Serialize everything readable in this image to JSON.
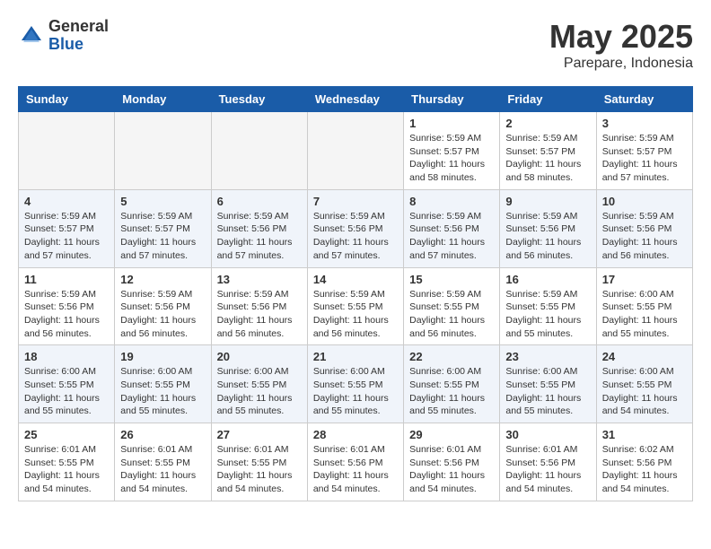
{
  "header": {
    "logo_general": "General",
    "logo_blue": "Blue",
    "month_title": "May 2025",
    "location": "Parepare, Indonesia"
  },
  "weekdays": [
    "Sunday",
    "Monday",
    "Tuesday",
    "Wednesday",
    "Thursday",
    "Friday",
    "Saturday"
  ],
  "weeks": [
    [
      {
        "day": "",
        "info": ""
      },
      {
        "day": "",
        "info": ""
      },
      {
        "day": "",
        "info": ""
      },
      {
        "day": "",
        "info": ""
      },
      {
        "day": "1",
        "info": "Sunrise: 5:59 AM\nSunset: 5:57 PM\nDaylight: 11 hours\nand 58 minutes."
      },
      {
        "day": "2",
        "info": "Sunrise: 5:59 AM\nSunset: 5:57 PM\nDaylight: 11 hours\nand 58 minutes."
      },
      {
        "day": "3",
        "info": "Sunrise: 5:59 AM\nSunset: 5:57 PM\nDaylight: 11 hours\nand 57 minutes."
      }
    ],
    [
      {
        "day": "4",
        "info": "Sunrise: 5:59 AM\nSunset: 5:57 PM\nDaylight: 11 hours\nand 57 minutes."
      },
      {
        "day": "5",
        "info": "Sunrise: 5:59 AM\nSunset: 5:57 PM\nDaylight: 11 hours\nand 57 minutes."
      },
      {
        "day": "6",
        "info": "Sunrise: 5:59 AM\nSunset: 5:56 PM\nDaylight: 11 hours\nand 57 minutes."
      },
      {
        "day": "7",
        "info": "Sunrise: 5:59 AM\nSunset: 5:56 PM\nDaylight: 11 hours\nand 57 minutes."
      },
      {
        "day": "8",
        "info": "Sunrise: 5:59 AM\nSunset: 5:56 PM\nDaylight: 11 hours\nand 57 minutes."
      },
      {
        "day": "9",
        "info": "Sunrise: 5:59 AM\nSunset: 5:56 PM\nDaylight: 11 hours\nand 56 minutes."
      },
      {
        "day": "10",
        "info": "Sunrise: 5:59 AM\nSunset: 5:56 PM\nDaylight: 11 hours\nand 56 minutes."
      }
    ],
    [
      {
        "day": "11",
        "info": "Sunrise: 5:59 AM\nSunset: 5:56 PM\nDaylight: 11 hours\nand 56 minutes."
      },
      {
        "day": "12",
        "info": "Sunrise: 5:59 AM\nSunset: 5:56 PM\nDaylight: 11 hours\nand 56 minutes."
      },
      {
        "day": "13",
        "info": "Sunrise: 5:59 AM\nSunset: 5:56 PM\nDaylight: 11 hours\nand 56 minutes."
      },
      {
        "day": "14",
        "info": "Sunrise: 5:59 AM\nSunset: 5:55 PM\nDaylight: 11 hours\nand 56 minutes."
      },
      {
        "day": "15",
        "info": "Sunrise: 5:59 AM\nSunset: 5:55 PM\nDaylight: 11 hours\nand 56 minutes."
      },
      {
        "day": "16",
        "info": "Sunrise: 5:59 AM\nSunset: 5:55 PM\nDaylight: 11 hours\nand 55 minutes."
      },
      {
        "day": "17",
        "info": "Sunrise: 6:00 AM\nSunset: 5:55 PM\nDaylight: 11 hours\nand 55 minutes."
      }
    ],
    [
      {
        "day": "18",
        "info": "Sunrise: 6:00 AM\nSunset: 5:55 PM\nDaylight: 11 hours\nand 55 minutes."
      },
      {
        "day": "19",
        "info": "Sunrise: 6:00 AM\nSunset: 5:55 PM\nDaylight: 11 hours\nand 55 minutes."
      },
      {
        "day": "20",
        "info": "Sunrise: 6:00 AM\nSunset: 5:55 PM\nDaylight: 11 hours\nand 55 minutes."
      },
      {
        "day": "21",
        "info": "Sunrise: 6:00 AM\nSunset: 5:55 PM\nDaylight: 11 hours\nand 55 minutes."
      },
      {
        "day": "22",
        "info": "Sunrise: 6:00 AM\nSunset: 5:55 PM\nDaylight: 11 hours\nand 55 minutes."
      },
      {
        "day": "23",
        "info": "Sunrise: 6:00 AM\nSunset: 5:55 PM\nDaylight: 11 hours\nand 55 minutes."
      },
      {
        "day": "24",
        "info": "Sunrise: 6:00 AM\nSunset: 5:55 PM\nDaylight: 11 hours\nand 54 minutes."
      }
    ],
    [
      {
        "day": "25",
        "info": "Sunrise: 6:01 AM\nSunset: 5:55 PM\nDaylight: 11 hours\nand 54 minutes."
      },
      {
        "day": "26",
        "info": "Sunrise: 6:01 AM\nSunset: 5:55 PM\nDaylight: 11 hours\nand 54 minutes."
      },
      {
        "day": "27",
        "info": "Sunrise: 6:01 AM\nSunset: 5:55 PM\nDaylight: 11 hours\nand 54 minutes."
      },
      {
        "day": "28",
        "info": "Sunrise: 6:01 AM\nSunset: 5:56 PM\nDaylight: 11 hours\nand 54 minutes."
      },
      {
        "day": "29",
        "info": "Sunrise: 6:01 AM\nSunset: 5:56 PM\nDaylight: 11 hours\nand 54 minutes."
      },
      {
        "day": "30",
        "info": "Sunrise: 6:01 AM\nSunset: 5:56 PM\nDaylight: 11 hours\nand 54 minutes."
      },
      {
        "day": "31",
        "info": "Sunrise: 6:02 AM\nSunset: 5:56 PM\nDaylight: 11 hours\nand 54 minutes."
      }
    ]
  ]
}
